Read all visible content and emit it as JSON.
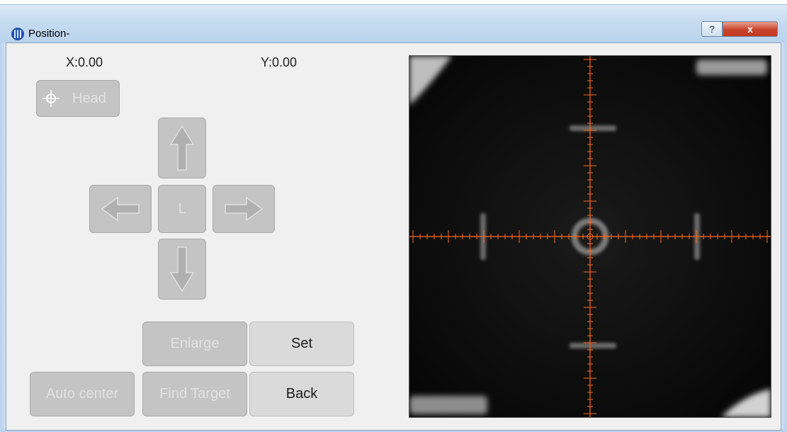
{
  "window": {
    "title": "Position-",
    "help_label": "?",
    "close_label": "x"
  },
  "coords": {
    "x_label": "X:0.00",
    "y_label": "Y:0.00"
  },
  "controls": {
    "head_label": "Head",
    "center_label": "L",
    "enlarge_label": "Enlarge",
    "set_label": "Set",
    "auto_center_label": "Auto center",
    "find_target_label": "Find Target",
    "back_label": "Back"
  },
  "icons": {
    "app": "app-logo-icon",
    "head": "crosshair-icon",
    "up": "arrow-up-icon",
    "down": "arrow-down-icon",
    "left": "arrow-left-icon",
    "right": "arrow-right-icon"
  },
  "colors": {
    "reticle": "#ff6a1a",
    "disabled_button": "#c4c4c4",
    "enabled_button": "#dadada",
    "camera_bg": "#0c0c0c"
  }
}
